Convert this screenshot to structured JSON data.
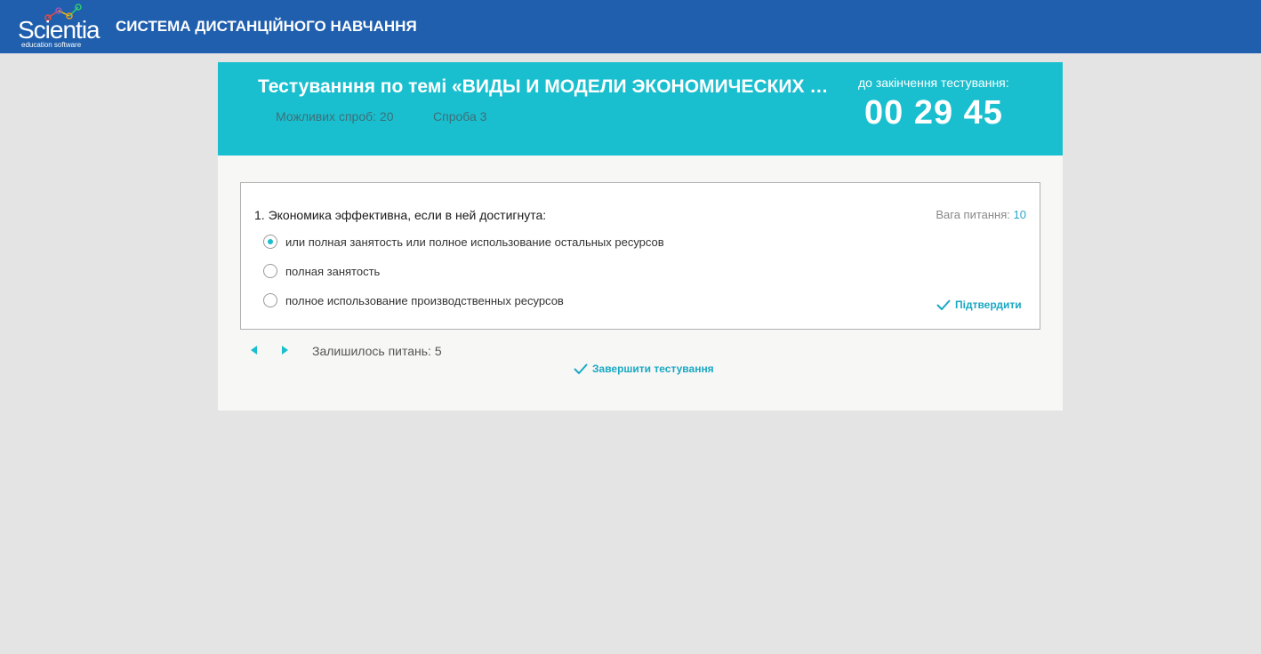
{
  "header": {
    "logo_text": "Scientia",
    "logo_subtext": "education software",
    "system_title": "СИСТЕМА ДИСТАНЦІЙНОГО НАВЧАННЯ"
  },
  "test": {
    "title": "Тестуванння по темі «ВИДЫ И МОДЕЛИ ЭКОНОМИЧЕСКИХ СИСТЕМ»",
    "attempts_allowed": "Можливих спроб: 20",
    "attempt_current": "Спроба 3",
    "timer_label": "до закінчення тестування:",
    "timer_value": "00 29 45"
  },
  "question": {
    "text": "1. Экономика эффективна, если в ней достигнута:",
    "weight_label": "Вага питання:",
    "weight_value": "10",
    "options": [
      {
        "label": "или полная занятость или полное использование остальных ресурсов",
        "checked": true
      },
      {
        "label": "полная занятость",
        "checked": false
      },
      {
        "label": "полное использование производственных ресурсов",
        "checked": false
      }
    ],
    "confirm_label": "Підтвердити"
  },
  "footer": {
    "remaining": "Залишилось питань: 5",
    "finish_label": "Завершити тестування"
  },
  "colors": {
    "topbar": "#1f5fad",
    "accent": "#1abfcf",
    "link": "#1aa8c4"
  },
  "icons": {
    "prev": "triangle-left-icon",
    "next": "triangle-right-icon",
    "check": "check-icon"
  }
}
